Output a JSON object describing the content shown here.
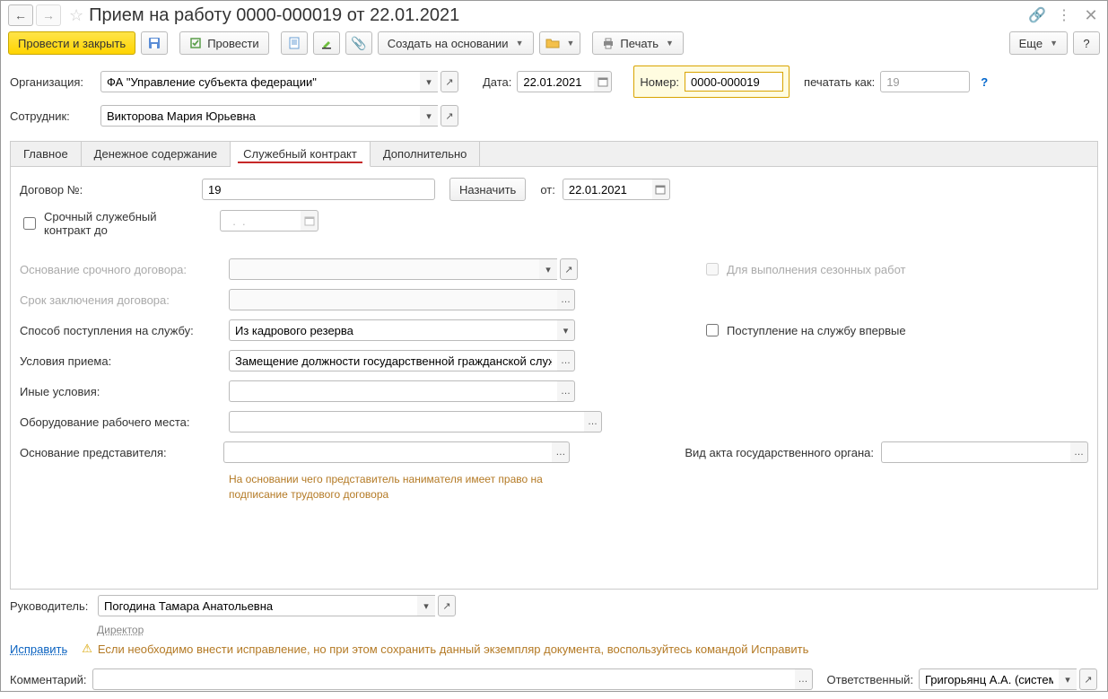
{
  "title": "Прием на работу 0000-000019 от 22.01.2021",
  "toolbar": {
    "postAndClose": "Провести и закрыть",
    "post": "Провести",
    "createBased": "Создать на основании",
    "print": "Печать",
    "more": "Еще",
    "help": "?"
  },
  "fields": {
    "orgLabel": "Организация:",
    "orgValue": "ФА \"Управление субъекта федерации\"",
    "dateLabel": "Дата:",
    "dateValue": "22.01.2021",
    "numberLabel": "Номер:",
    "numberValue": "0000-000019",
    "printAsLabel": "печатать как:",
    "printAsValue": "19",
    "employeeLabel": "Сотрудник:",
    "employeeValue": "Викторова Мария Юрьевна"
  },
  "tabs": {
    "t1": "Главное",
    "t2": "Денежное содержание",
    "t3": "Служебный контракт",
    "t4": "Дополнительно"
  },
  "contract": {
    "contractNoLabel": "Договор №:",
    "contractNoValue": "19",
    "assignBtn": "Назначить",
    "fromLabel": "от:",
    "fromValue": "22.01.2021",
    "urgentLabel": "Срочный служебный контракт до",
    "urgentDate": "  .  .    ",
    "basisUrgentLabel": "Основание срочного договора:",
    "seasonalLabel": "Для выполнения сезонных работ",
    "termLabel": "Срок заключения договора:",
    "entryMethodLabel": "Способ поступления на службу:",
    "entryMethodValue": "Из кадрового резерва",
    "firstTimeLabel": "Поступление на службу впервые",
    "conditionsLabel": "Условия приема:",
    "conditionsValue": "Замещение должности государственной гражданской службы",
    "otherCondLabel": "Иные условия:",
    "equipmentLabel": "Оборудование рабочего места:",
    "reprBasisLabel": "Основание представителя:",
    "actTypeLabel": "Вид акта государственного органа:",
    "hint": "На основании чего представитель нанимателя имеет право на подписание трудового договора"
  },
  "bottom": {
    "managerLabel": "Руководитель:",
    "managerValue": "Погодина Тамара Анатольевна",
    "managerPost": "Директор",
    "fixLink": "Исправить",
    "fixHint": "Если необходимо внести исправление, но при этом сохранить данный экземпляр документа, воспользуйтесь командой Исправить",
    "commentLabel": "Комментарий:",
    "responsibleLabel": "Ответственный:",
    "responsibleValue": "Григорьянц А.А. (системн"
  }
}
